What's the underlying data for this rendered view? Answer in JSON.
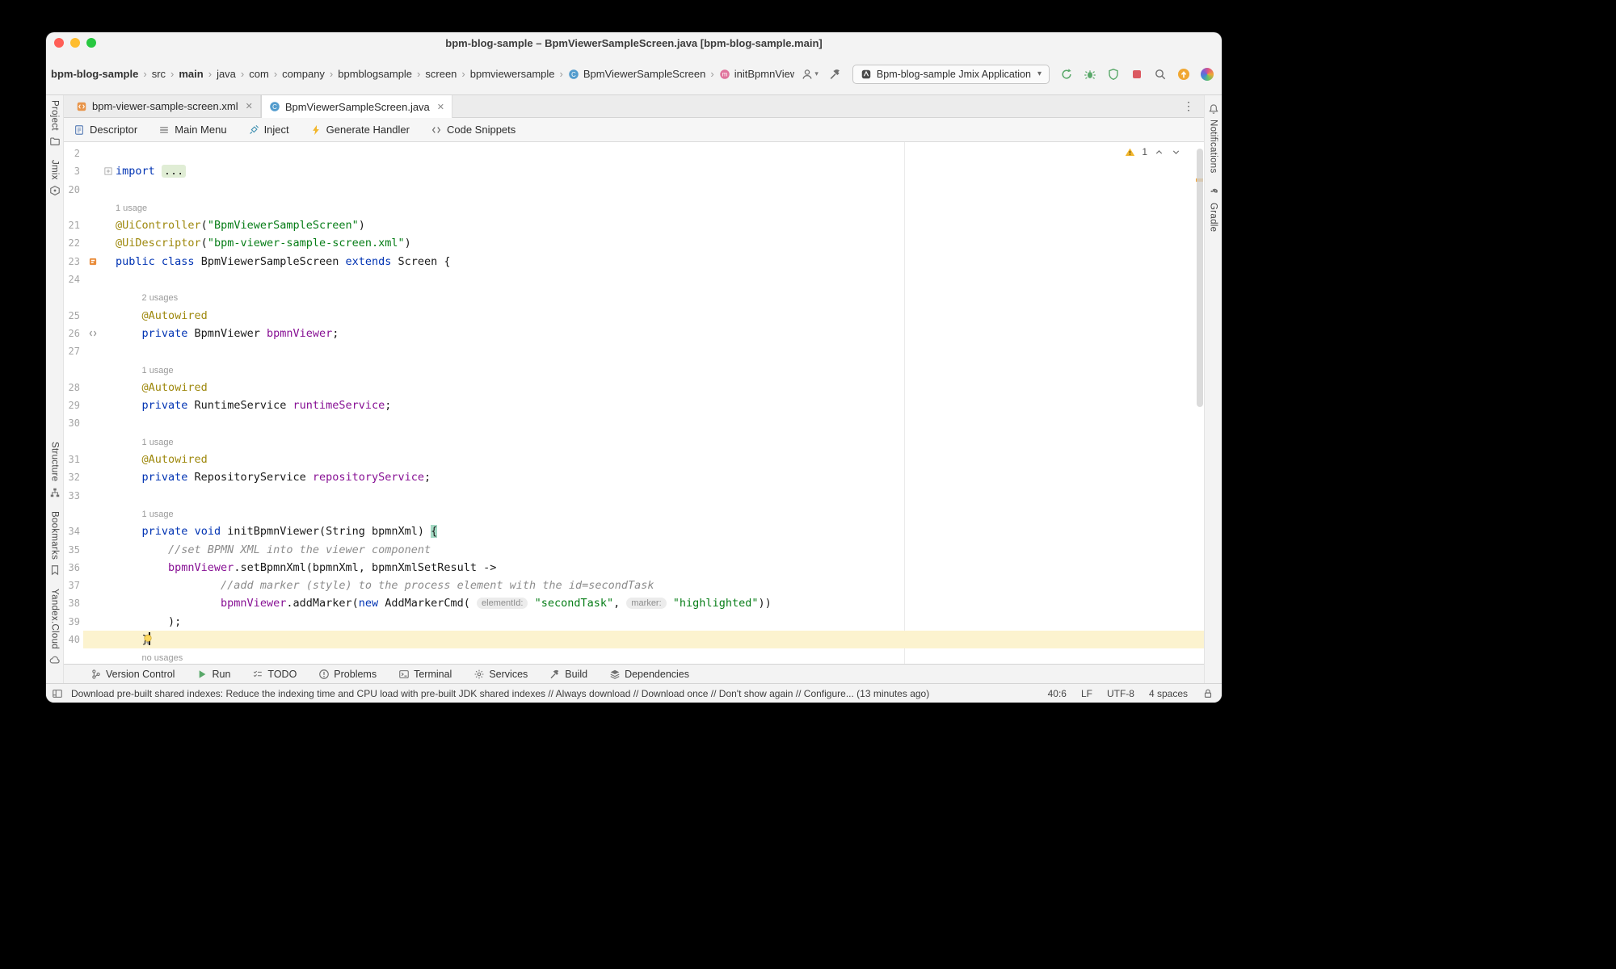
{
  "window": {
    "title": "bpm-blog-sample – BpmViewerSampleScreen.java [bpm-blog-sample.main]"
  },
  "breadcrumbs": [
    {
      "label": "bpm-blog-sample",
      "bold": true
    },
    {
      "label": "src"
    },
    {
      "label": "main",
      "bold": true
    },
    {
      "label": "java"
    },
    {
      "label": "com"
    },
    {
      "label": "company"
    },
    {
      "label": "bpmblogsample"
    },
    {
      "label": "screen"
    },
    {
      "label": "bpmviewersample"
    },
    {
      "label": "BpmViewerSampleScreen",
      "icon": "class"
    },
    {
      "label": "initBpmnViewer",
      "icon": "method"
    }
  ],
  "toolbar": {
    "run_config": "Bpm-blog-sample Jmix Application"
  },
  "tabs": [
    {
      "label": "bpm-viewer-sample-screen.xml",
      "icon": "xml",
      "active": false
    },
    {
      "label": "BpmViewerSampleScreen.java",
      "icon": "class",
      "active": true
    }
  ],
  "jmix_toolbar": [
    {
      "label": "Descriptor",
      "icon": "descriptor"
    },
    {
      "label": "Main Menu",
      "icon": "menu"
    },
    {
      "label": "Inject",
      "icon": "inject"
    },
    {
      "label": "Generate Handler",
      "icon": "lightning"
    },
    {
      "label": "Code Snippets",
      "icon": "snippets"
    }
  ],
  "left_stripe": {
    "top": [
      {
        "label": "Project",
        "icon": "folder"
      },
      {
        "label": "Jmix",
        "icon": "jmix"
      }
    ],
    "bottom": [
      {
        "label": "Structure",
        "icon": "structure"
      },
      {
        "label": "Bookmarks",
        "icon": "bookmarks"
      },
      {
        "label": "Yandex.Cloud",
        "icon": "cloud"
      }
    ]
  },
  "right_stripe": [
    {
      "label": "Notifications",
      "icon": "bell"
    },
    {
      "label": "Gradle",
      "icon": "gradle"
    }
  ],
  "editor": {
    "warning_count": "1",
    "lines": [
      {
        "num": "2",
        "tokens": []
      },
      {
        "num": "3",
        "fold": true,
        "tokens": [
          {
            "t": "kw",
            "v": "import"
          },
          {
            "t": "plain",
            "v": " "
          },
          {
            "t": "foldchip",
            "v": "..."
          }
        ]
      },
      {
        "num": "20",
        "tokens": []
      },
      {
        "usage": "1 usage",
        "indent": 0
      },
      {
        "num": "21",
        "tokens": [
          {
            "t": "ann",
            "v": "@UiController"
          },
          {
            "t": "plain",
            "v": "("
          },
          {
            "t": "str",
            "v": "\"BpmViewerSampleScreen\""
          },
          {
            "t": "plain",
            "v": ")"
          }
        ]
      },
      {
        "num": "22",
        "tokens": [
          {
            "t": "ann",
            "v": "@UiDescriptor"
          },
          {
            "t": "plain",
            "v": "("
          },
          {
            "t": "str",
            "v": "\"bpm-viewer-sample-screen.xml\""
          },
          {
            "t": "plain",
            "v": ")"
          }
        ]
      },
      {
        "num": "23",
        "gicon": "screen-class",
        "tokens": [
          {
            "t": "kw",
            "v": "public"
          },
          {
            "t": "plain",
            "v": " "
          },
          {
            "t": "kw",
            "v": "class"
          },
          {
            "t": "plain",
            "v": " BpmViewerSampleScreen "
          },
          {
            "t": "kw",
            "v": "extends"
          },
          {
            "t": "plain",
            "v": " Screen {"
          }
        ]
      },
      {
        "num": "24",
        "tokens": []
      },
      {
        "usage": "2 usages",
        "indent": 4
      },
      {
        "num": "25",
        "tokens": [
          {
            "t": "plain",
            "v": "    "
          },
          {
            "t": "ann",
            "v": "@Autowired"
          }
        ]
      },
      {
        "num": "26",
        "gicon": "brackets",
        "tokens": [
          {
            "t": "plain",
            "v": "    "
          },
          {
            "t": "kw",
            "v": "private"
          },
          {
            "t": "plain",
            "v": " BpmnViewer "
          },
          {
            "t": "field",
            "v": "bpmnViewer"
          },
          {
            "t": "plain",
            "v": ";"
          }
        ]
      },
      {
        "num": "27",
        "tokens": []
      },
      {
        "usage": "1 usage",
        "indent": 4
      },
      {
        "num": "28",
        "tokens": [
          {
            "t": "plain",
            "v": "    "
          },
          {
            "t": "ann",
            "v": "@Autowired"
          }
        ]
      },
      {
        "num": "29",
        "tokens": [
          {
            "t": "plain",
            "v": "    "
          },
          {
            "t": "kw",
            "v": "private"
          },
          {
            "t": "plain",
            "v": " RuntimeService "
          },
          {
            "t": "field",
            "v": "runtimeService"
          },
          {
            "t": "plain",
            "v": ";"
          }
        ]
      },
      {
        "num": "30",
        "tokens": []
      },
      {
        "usage": "1 usage",
        "indent": 4
      },
      {
        "num": "31",
        "tokens": [
          {
            "t": "plain",
            "v": "    "
          },
          {
            "t": "ann",
            "v": "@Autowired"
          }
        ]
      },
      {
        "num": "32",
        "tokens": [
          {
            "t": "plain",
            "v": "    "
          },
          {
            "t": "kw",
            "v": "private"
          },
          {
            "t": "plain",
            "v": " RepositoryService "
          },
          {
            "t": "field",
            "v": "repositoryService"
          },
          {
            "t": "plain",
            "v": ";"
          }
        ]
      },
      {
        "num": "33",
        "tokens": []
      },
      {
        "usage": "1 usage",
        "indent": 4
      },
      {
        "num": "34",
        "tokens": [
          {
            "t": "plain",
            "v": "    "
          },
          {
            "t": "kw",
            "v": "private"
          },
          {
            "t": "plain",
            "v": " "
          },
          {
            "t": "kw",
            "v": "void"
          },
          {
            "t": "plain",
            "v": " initBpmnViewer(String bpmnXml) "
          },
          {
            "t": "brace",
            "v": "{"
          }
        ]
      },
      {
        "num": "35",
        "tokens": [
          {
            "t": "plain",
            "v": "        "
          },
          {
            "t": "com",
            "v": "//set BPMN XML into the viewer component"
          }
        ]
      },
      {
        "num": "36",
        "tokens": [
          {
            "t": "plain",
            "v": "        "
          },
          {
            "t": "field",
            "v": "bpmnViewer"
          },
          {
            "t": "plain",
            "v": ".setBpmnXml(bpmnXml, bpmnXmlSetResult ->"
          }
        ]
      },
      {
        "num": "37",
        "tokens": [
          {
            "t": "plain",
            "v": "                "
          },
          {
            "t": "com",
            "v": "//add marker (style) to the process element with the id=secondTask"
          }
        ]
      },
      {
        "num": "38",
        "tokens": [
          {
            "t": "plain",
            "v": "                "
          },
          {
            "t": "field",
            "v": "bpmnViewer"
          },
          {
            "t": "plain",
            "v": ".addMarker("
          },
          {
            "t": "kw",
            "v": "new"
          },
          {
            "t": "plain",
            "v": " AddMarkerCmd( "
          },
          {
            "t": "inlay",
            "v": "elementId:"
          },
          {
            "t": "plain",
            "v": " "
          },
          {
            "t": "str",
            "v": "\"secondTask\""
          },
          {
            "t": "plain",
            "v": ", "
          },
          {
            "t": "inlay",
            "v": "marker:"
          },
          {
            "t": "plain",
            "v": " "
          },
          {
            "t": "str",
            "v": "\"highlighted\""
          },
          {
            "t": "plain",
            "v": "))"
          }
        ]
      },
      {
        "num": "39",
        "tokens": [
          {
            "t": "plain",
            "v": "        );"
          }
        ]
      },
      {
        "num": "40",
        "current": true,
        "bulb": true,
        "caret": true,
        "tokens": [
          {
            "t": "plain",
            "v": "    }"
          }
        ]
      },
      {
        "usage": "no usages",
        "indent": 4
      }
    ]
  },
  "bottom_toolbar": [
    {
      "label": "Version Control",
      "icon": "vcs"
    },
    {
      "label": "Run",
      "icon": "play"
    },
    {
      "label": "TODO",
      "icon": "todo"
    },
    {
      "label": "Problems",
      "icon": "problems"
    },
    {
      "label": "Terminal",
      "icon": "terminal"
    },
    {
      "label": "Services",
      "icon": "services"
    },
    {
      "label": "Build",
      "icon": "hammer"
    },
    {
      "label": "Dependencies",
      "icon": "deps"
    }
  ],
  "status_bar": {
    "message": "Download pre-built shared indexes: Reduce the indexing time and CPU load with pre-built JDK shared indexes // Always download // Download once // Don't show again // Configure... (13 minutes ago)",
    "caret": "40:6",
    "line_ending": "LF",
    "encoding": "UTF-8",
    "indent": "4 spaces"
  }
}
